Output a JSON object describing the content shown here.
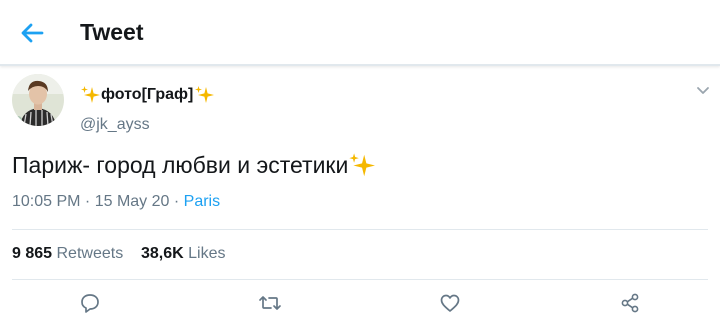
{
  "header": {
    "title": "Tweet",
    "back_icon": "arrow-left-icon"
  },
  "author": {
    "display_name": "фото[Граф]",
    "handle": "@jk_ayss",
    "name_decoration_icon": "sparkles-icon"
  },
  "tweet": {
    "text": "Париж- город любви и эстетики",
    "text_decoration_icon": "sparkles-icon",
    "time": "10:05 PM",
    "separator1": " · ",
    "date": "15 May 20",
    "separator2": " · ",
    "location": "Paris"
  },
  "stats": {
    "retweets_count": "9 865",
    "retweets_label": "Retweets",
    "likes_count": "38,6K",
    "likes_label": "Likes"
  },
  "actions": [
    "reply-icon",
    "retweet-icon",
    "like-icon",
    "share-icon"
  ],
  "colors": {
    "accent": "#1da1f2",
    "text_primary": "#14171a",
    "text_secondary": "#657786",
    "divider": "#e1e8ed",
    "sparkle": "#f5b800"
  }
}
